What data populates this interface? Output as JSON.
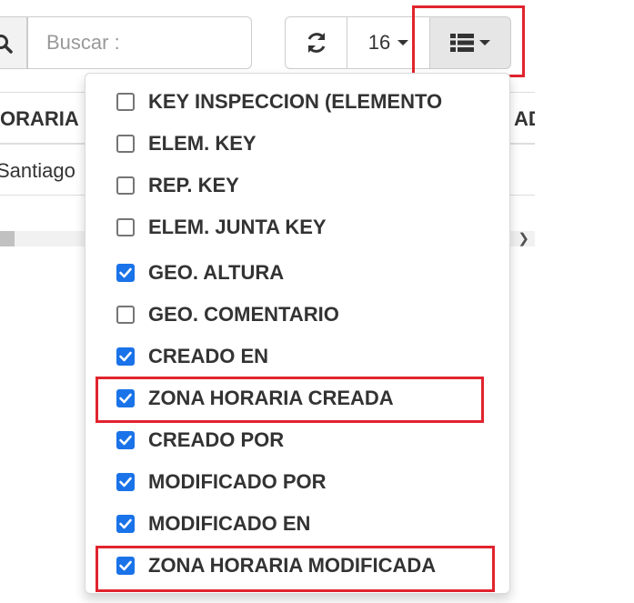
{
  "search": {
    "placeholder": "Buscar :"
  },
  "toolbar": {
    "page_size": "16"
  },
  "table": {
    "header_left": "ORARIA C",
    "header_right": "AD",
    "row_left": "Santiago"
  },
  "column_menu": {
    "items": [
      {
        "label": "KEY INSPECCION (ELEMENTO",
        "checked": false
      },
      {
        "label": "ELEM. KEY",
        "checked": false
      },
      {
        "label": "REP. KEY",
        "checked": false
      },
      {
        "label": "ELEM. JUNTA KEY",
        "checked": false
      },
      {
        "label": "GEO. ALTURA",
        "checked": true
      },
      {
        "label": "GEO. COMENTARIO",
        "checked": false
      },
      {
        "label": "CREADO EN",
        "checked": true
      },
      {
        "label": "ZONA HORARIA CREADA",
        "checked": true
      },
      {
        "label": "CREADO POR",
        "checked": true
      },
      {
        "label": "MODIFICADO POR",
        "checked": true
      },
      {
        "label": "MODIFICADO EN",
        "checked": true
      },
      {
        "label": "ZONA HORARIA MODIFICADA",
        "checked": true
      }
    ]
  },
  "colors": {
    "checkbox_checked": "#1a73e8",
    "highlight": "#e0242e"
  }
}
